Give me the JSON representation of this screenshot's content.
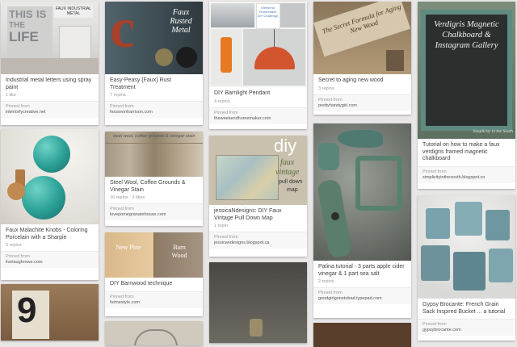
{
  "pins": [
    {
      "id": "p1",
      "description": "Industrial metal letters using spray paint",
      "stats": "1 like",
      "source_label": "Pinned from",
      "source": "interiorfycreative.net",
      "overlay_lines": [
        "THIS",
        "IS",
        "THE",
        "LIFE"
      ],
      "overlay_tag": "FAUX INDUSTRIAL METAL"
    },
    {
      "id": "p2",
      "description": "Easy-Peasy {Faux} Rust Treatment",
      "stats": "7 repins",
      "source_label": "Pinned from",
      "source": "houseonharrison.com",
      "overlay_letter": "c",
      "overlay_title": "Faux Rusted Metal"
    },
    {
      "id": "p3",
      "description": "DIY Barnlight Pendant",
      "stats": "4 repins",
      "source_label": "Pinned from",
      "source": "theweekendhomemaker.com",
      "overlay_tag": "Weekend Homemaker DIY Challenge"
    },
    {
      "id": "p4",
      "description": "Secret to aging new wood",
      "stats": "3 repins",
      "source_label": "Pinned from",
      "source": "prettyhandygirl.com",
      "overlay_title": "The Secret Formula for Aging New Wood"
    },
    {
      "id": "p5",
      "description": "Tutorial on how to make a faux verdigris framed magnetic chalkboard",
      "stats": "",
      "source_label": "Pinned from",
      "source": "simplicityinthesouth.blogspot.co",
      "overlay_title": "Verdigris Magnetic Chalkboard & Instagram Gallery",
      "overlay_sub": "Simplicity in the South"
    },
    {
      "id": "p6",
      "description": "Faux Malachite Knobs - Coloring Porcelain with a Sharpie",
      "stats": "5 repins",
      "source_label": "Pinned from",
      "source": "livelaughrowe.com"
    },
    {
      "id": "p7",
      "description": "Steel Wool, Coffee Grounds & Vinegar Stain",
      "stats": "16 repins · 3 likes",
      "source_label": "Pinned from",
      "source": "lovepomegranatehouse.com",
      "overlay_tag": "steel wool, coffee grounds & vinegar stain"
    },
    {
      "id": "p8",
      "description": "jessicaNdesigns: DIY Faux Vintage Pull Down Map",
      "stats": "1 repin",
      "source_label": "Pinned from",
      "source": "jessicandesigns.blogspot.ca",
      "overlay_diy": "diy",
      "overlay_lines": [
        "faux",
        "vintage",
        "pull down",
        "map"
      ]
    },
    {
      "id": "p9",
      "description": "Patina tutorial - 3 parts apple cider vinegar & 1 part sea salt",
      "stats": "2 repins",
      "source_label": "Pinned from",
      "source": "goodgirlgonetobad.typepad.com"
    },
    {
      "id": "p10",
      "description": "DIY Barnwood technique",
      "stats": "",
      "source_label": "Pinned from",
      "source": "homestyle.com",
      "overlay_lines": [
        "New Pine",
        "Barn Wood"
      ]
    },
    {
      "id": "p11",
      "description": "Gypsy Brocante: French Grain Sack Inspired Bucket ... a tutorial",
      "stats": "",
      "source_label": "Pinned from",
      "source": "gypsybrocante.com"
    },
    {
      "id": "p12",
      "description": "",
      "stats": "",
      "source_label": "",
      "source": "",
      "overlay_letter": "9"
    },
    {
      "id": "p13",
      "description": "",
      "stats": "",
      "source_label": "",
      "source": ""
    },
    {
      "id": "p14",
      "description": "",
      "stats": "",
      "source_label": "",
      "source": ""
    },
    {
      "id": "p15",
      "description": "",
      "stats": "",
      "source_label": "",
      "source": ""
    }
  ]
}
